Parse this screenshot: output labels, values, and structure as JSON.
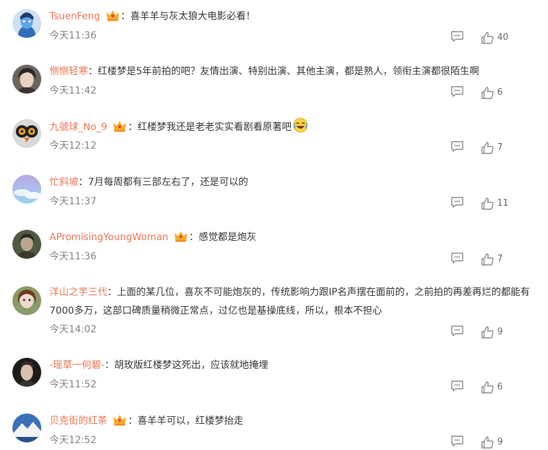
{
  "comments": [
    {
      "user": "TsuenFeng",
      "crown": true,
      "text": "：喜羊羊与灰太狼大电影必看！",
      "emoji": false,
      "time": "今天11:36",
      "likes": "40",
      "avatar": "avatar-blue-hero"
    },
    {
      "user": "恻恻轻寒",
      "crown": false,
      "text": "：红楼梦是5年前拍的吧？友情出演、特别出演、其他主演，都是熟人，领衔主演都很陌生啊",
      "emoji": false,
      "time": "今天11:42",
      "likes": "6",
      "avatar": "avatar-dark-hair"
    },
    {
      "user": "九號球_No_9",
      "crown": true,
      "text": "：红楼梦我还是老老实实看剧看原著吧",
      "emoji": true,
      "emoji_name": "laugh-cry-emoji",
      "time": "今天12:12",
      "likes": "7",
      "avatar": "avatar-bird"
    },
    {
      "user": "忙斜坡",
      "crown": false,
      "text": "：7月每周都有三部左右了，还是可以的",
      "emoji": false,
      "time": "今天11:37",
      "likes": "11",
      "avatar": "avatar-sky"
    },
    {
      "user": "APromisingYoungWoman",
      "crown": true,
      "text": "：感觉都是炮灰",
      "emoji": false,
      "time": "今天11:36",
      "likes": "7",
      "avatar": "avatar-portrait"
    },
    {
      "user": "洋山之芋三代",
      "crown": false,
      "text": "：上面的某几位，喜灰不可能炮灰的，传统影响力跟IP名声摆在面前的，之前拍的再差再烂的都能有7000多万，这部口碑质量稍微正常点，过亿也是基操底线，所以，根本不担心",
      "emoji": false,
      "time": "今天14:02",
      "likes": "9",
      "avatar": "avatar-doll"
    },
    {
      "user": "-瑶草一何碧-",
      "crown": false,
      "text": "：胡玫版红楼梦这死出，应该就地掩埋",
      "emoji": false,
      "time": "今天11:52",
      "likes": "6",
      "avatar": "avatar-man"
    },
    {
      "user": "贝克街的红茶",
      "crown": true,
      "text": "：喜羊羊可以，红楼梦抬走",
      "emoji": false,
      "time": "今天12:52",
      "likes": "9",
      "avatar": "avatar-mountain"
    }
  ],
  "colors": {
    "username": "#eb7350",
    "time": "#808080",
    "text": "#333333",
    "icon": "#888888"
  },
  "icons": {
    "reply": "comment-icon",
    "like": "thumbs-up-icon",
    "badge": "crown-icon"
  }
}
